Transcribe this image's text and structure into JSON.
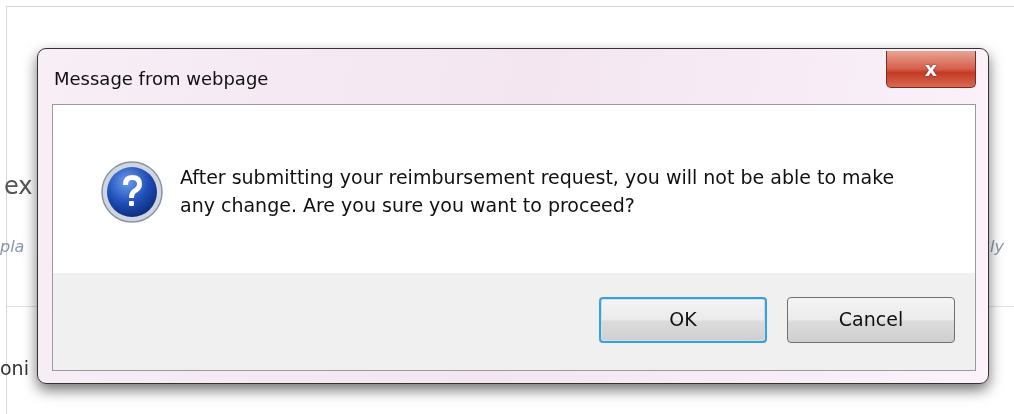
{
  "background_page": {
    "fragments": [
      {
        "text": "ex",
        "kind": "heading"
      },
      {
        "text": "pla",
        "kind": "hint"
      },
      {
        "text": "ly",
        "kind": "hint-right"
      },
      {
        "text": "oni",
        "kind": "body"
      }
    ]
  },
  "dialog": {
    "title": "Message from webpage",
    "close_label": "x",
    "message": "After submitting your reimbursement request, you will not be able to make any change. Are you sure you want to proceed?",
    "buttons": [
      {
        "label": "OK",
        "selected": true
      },
      {
        "label": "Cancel",
        "selected": false
      }
    ]
  }
}
